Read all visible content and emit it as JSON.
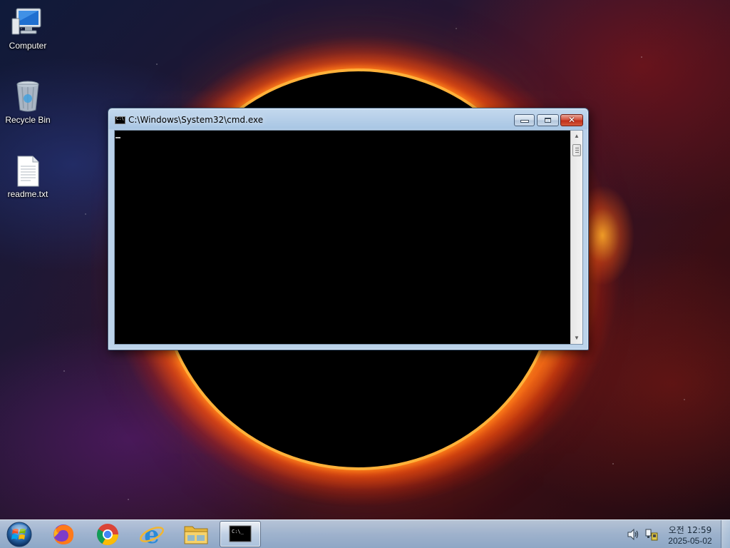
{
  "desktop": {
    "icons": [
      {
        "label": "Computer",
        "icon": "computer-icon"
      },
      {
        "label": "Recycle Bin",
        "icon": "recycle-bin-icon"
      },
      {
        "label": "readme.txt",
        "icon": "text-file-icon"
      }
    ]
  },
  "window": {
    "title": "C:\\Windows\\System32\\cmd.exe",
    "icon_text": "C:\\",
    "console_text": "",
    "buttons": {
      "minimize": "minimize",
      "maximize": "maximize",
      "close": "close"
    },
    "close_glyph": "✕"
  },
  "taskbar": {
    "start": "start-orb-icon",
    "pinned": [
      {
        "name": "firefox",
        "icon": "firefox-icon"
      },
      {
        "name": "chrome",
        "icon": "chrome-icon"
      },
      {
        "name": "internet-explorer",
        "icon": "internet-explorer-icon"
      },
      {
        "name": "file-explorer",
        "icon": "folder-icon"
      },
      {
        "name": "cmd",
        "icon": "command-prompt-icon",
        "label": "C:\\_",
        "active": true
      }
    ],
    "tray": {
      "time": "오전 12:59",
      "date": "2025-05-02"
    }
  },
  "colors": {
    "console_bg": "#000000",
    "console_fg": "#c0c0c0",
    "close_button": "#c1301a",
    "glass_frame": "#b9d1ea"
  }
}
